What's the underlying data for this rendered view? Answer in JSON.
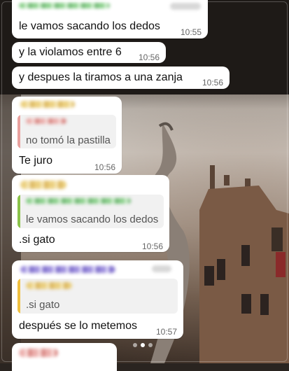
{
  "messages": [
    {
      "text": "le vamos sacando los dedos",
      "time": "10:55"
    },
    {
      "text": "y la violamos entre 6",
      "time": "10:56"
    },
    {
      "text": "y despues la tiramos a una zanja",
      "time": "10:56"
    }
  ],
  "reply1": {
    "quote": "no tomó la pastilla",
    "text": "Te juro",
    "time": "10:56"
  },
  "reply2": {
    "quote": "le vamos sacando los dedos",
    "text": ".si gato",
    "time": "10:56"
  },
  "reply3": {
    "quote": ".si gato",
    "text": "después se lo metemos",
    "time": "10:57"
  },
  "colors": {
    "bubble": "#ffffff",
    "quote_bg": "#f1f1f1",
    "bar_pink": "#e9a19e",
    "bar_green": "#8bc34a",
    "bar_yellow": "#f0c040"
  },
  "carousel": {
    "pages": 3,
    "active": 1
  }
}
